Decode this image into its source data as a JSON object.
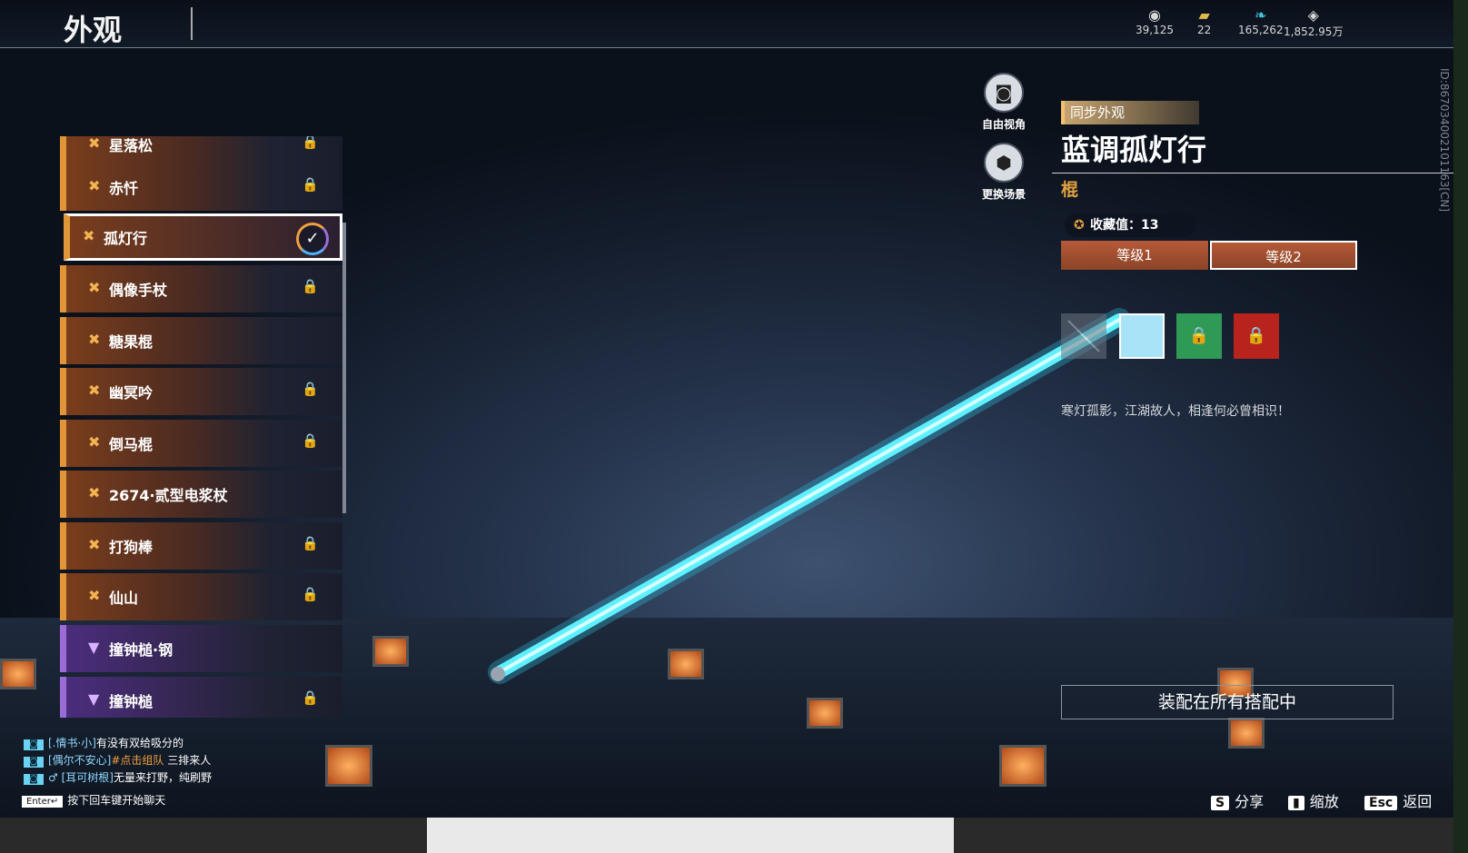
{
  "header": {
    "title": "外观"
  },
  "currencies": [
    {
      "icon": "coin-icon",
      "value": "39,125"
    },
    {
      "icon": "ticket-icon",
      "value": "22"
    },
    {
      "icon": "feather-icon",
      "value": "165,262"
    },
    {
      "icon": "diamond-icon",
      "value": "1,852.95万"
    }
  ],
  "side_id": "ID:867034002101163[CN]",
  "list": {
    "items": [
      {
        "label": "星落松",
        "locked": true
      },
      {
        "label": "赤忏",
        "locked": true
      },
      {
        "label": "孤灯行",
        "selected": true
      },
      {
        "label": "偶像手杖",
        "locked": true
      },
      {
        "label": "糖果棍",
        "locked": false
      },
      {
        "label": "幽冥吟",
        "locked": true
      },
      {
        "label": "倒马棍",
        "locked": true
      },
      {
        "label": "2674·贰型电浆杖",
        "locked": false
      },
      {
        "label": "打狗棒",
        "locked": true
      },
      {
        "label": "仙山",
        "locked": true
      },
      {
        "label": "撞钟槌·钢",
        "locked": false
      },
      {
        "label": "撞钟槌",
        "locked": true
      }
    ],
    "lock_glyph": "🔒",
    "check_glyph": "✓"
  },
  "camera": {
    "free_view": "自由视角",
    "change_scene": "更换场景"
  },
  "detail": {
    "sync_tag": "同步外观",
    "name": "蓝调孤灯行",
    "category": "棍",
    "collection": "收藏值：13",
    "level1": "等级1",
    "level2": "等级2",
    "description": "寒灯孤影，江湖故人，相逢何必曾相识！",
    "equip_all": "装配在所有搭配中",
    "swatch_colors": [
      "#6b7480",
      "#a8e4f8",
      "#2f9a56",
      "#b8231e"
    ]
  },
  "chat": {
    "lines": [
      {
        "who": "[.情书·小]",
        "msg": "有没有双给吸分的"
      },
      {
        "who": "[偶尔不安心]",
        "msg": "#点击组队",
        "extra": "三排来人"
      },
      {
        "who": "[耳可树根]",
        "msg": "无量来打野，纯刷野"
      }
    ],
    "enter_key": "Enter↵",
    "enter_hint": "按下回车键开始聊天"
  },
  "hints": [
    {
      "key": "S",
      "label": "分享"
    },
    {
      "key": "▮",
      "label": "缩放"
    },
    {
      "key": "Esc",
      "label": "返回"
    }
  ],
  "colors": {
    "accent_orange": "#e09638",
    "accent_purple": "#9b6cd6",
    "staff_glow": "#5ff0ff"
  }
}
